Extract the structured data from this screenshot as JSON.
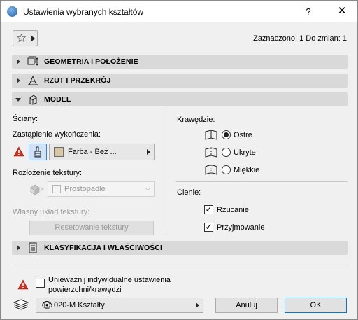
{
  "window": {
    "title": "Ustawienia wybranych kształtów",
    "help_label": "?",
    "close_label": "✕"
  },
  "selection_info": "Zaznaczono: 1 Do zmian: 1",
  "sections": {
    "geometry": "GEOMETRIA I POŁOŻENIE",
    "projection": "RZUT I PRZEKRÓJ",
    "model": "MODEL",
    "classification": "KLASYFIKACJA I WŁAŚCIWOŚCI"
  },
  "model": {
    "walls_label": "Ściany:",
    "finish_label": "Zastąpienie wykończenia:",
    "material": "Farba - Beż ...",
    "texture_layout_label": "Rozłożenie tekstury:",
    "texture_layout_value": "Prostopadle",
    "custom_texture_label": "Własny układ tekstury:",
    "reset_texture_label": "Resetowanie tekstury",
    "edges_label": "Krawędzie:",
    "edge_options": [
      "Ostre",
      "Ukryte",
      "Miękkie"
    ],
    "edge_selected": "Ostre",
    "shadows_label": "Cienie:",
    "shadow_cast_label": "Rzucanie",
    "shadow_receive_label": "Przyjmowanie"
  },
  "footer": {
    "override_line1": "Unieważnij indywidualne ustawienia",
    "override_line2": "powierzchni/krawędzi",
    "layer": "020-M Kształty",
    "cancel_label": "Anuluj",
    "ok_label": "OK"
  },
  "icons": {
    "app": "archicad-icon",
    "favorites": "star-icon",
    "warning": "warning-icon",
    "brush": "brush-icon",
    "eye": "eye-icon",
    "layers": "layers-icon"
  },
  "colors": {
    "section_bg": "#d9d9d9",
    "dialog_bg": "#f0f0f0",
    "accent": "#0078d7",
    "warning": "#d32f1e",
    "material_swatch": "#d8c7a6"
  }
}
